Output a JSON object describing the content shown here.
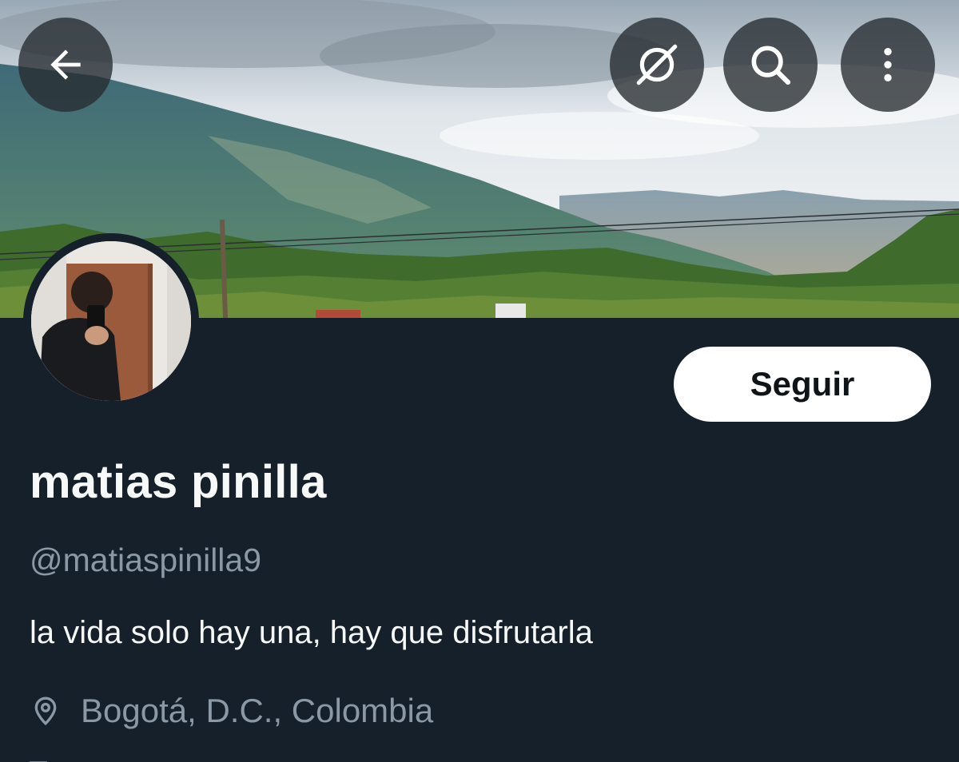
{
  "header": {
    "back_icon": "arrow-left-icon",
    "grok_icon": "grok-icon",
    "search_icon": "search-icon",
    "more_icon": "more-vertical-icon"
  },
  "profile": {
    "follow_label": "Seguir",
    "display_name": "matias pinilla",
    "handle": "@matiaspinilla9",
    "bio": "la vida solo hay una, hay que disfrutarla",
    "location": "Bogotá, D.C., Colombia",
    "location_icon": "location-pin-icon"
  },
  "colors": {
    "background": "#15202b",
    "secondary_text": "#8b98a5",
    "primary_text": "#f7f9f9",
    "button_bg": "#ffffff",
    "button_text": "#0f1419"
  }
}
